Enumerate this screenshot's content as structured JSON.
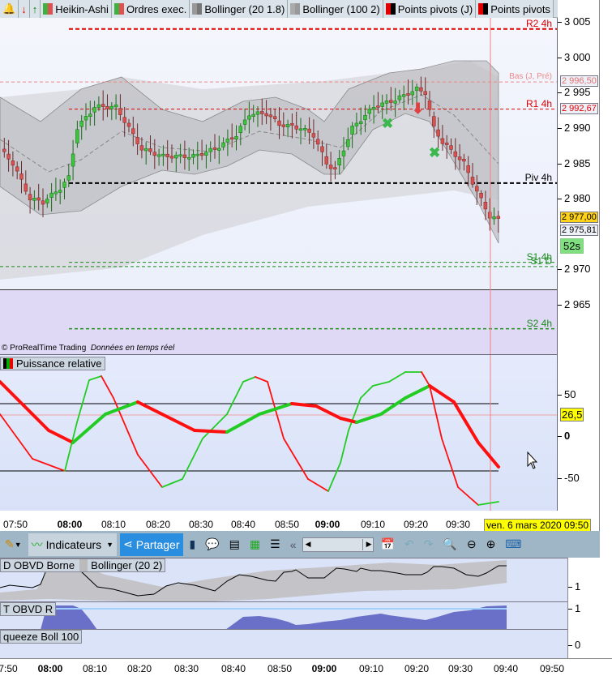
{
  "toolbar_top": {
    "items": [
      {
        "label": "Heikin-Ashi",
        "color": "#e05050",
        "color2": "#40b040"
      },
      {
        "label": "Ordres exec.",
        "color": "#e05050",
        "color2": "#40b040"
      },
      {
        "label": "Bollinger (20 1.8)",
        "color": "#777777",
        "color2": "#999999"
      },
      {
        "label": "Bollinger (100 2)",
        "color": "#999999",
        "color2": "#aaaaaa"
      },
      {
        "label": "Points pivots (J)",
        "color": "#000000",
        "color2": "#e00000"
      },
      {
        "label": "Points pivots",
        "color": "#000000",
        "color2": "#e00000"
      }
    ]
  },
  "price_axis": {
    "ticks": [
      "3 005",
      "3 000",
      "2 995",
      "2 990",
      "2 985",
      "2 980",
      "2 970",
      "2 965"
    ],
    "values": [
      3005,
      3000,
      2995,
      2990,
      2985,
      2980,
      2970,
      2965
    ],
    "tags": {
      "bas": "2 996,50",
      "r1": "2 992,67",
      "last": "2 977,00",
      "current": "2 975,81",
      "countdown": "52s"
    }
  },
  "levels": {
    "r2": "R2 4h",
    "bas": "Bas (J, Pré)",
    "r1": "R1 4h",
    "piv": "Piv 4h",
    "s1": "S1 4h",
    "s1d": "S1 D",
    "s2": "S2 4h"
  },
  "level_values": {
    "r2": 3004,
    "bas": 2996.5,
    "r1": 2992.67,
    "piv": 2982.2,
    "s1": 2971,
    "s1d": 2970.4,
    "s2": 2961.6
  },
  "copyright": "© ProRealTime Trading",
  "realtime": "Données en temps réel",
  "price_path": [
    [
      0,
      2987
    ],
    [
      3,
      2985
    ],
    [
      7,
      2980
    ],
    [
      10,
      2979.5
    ],
    [
      14,
      2981.5
    ],
    [
      16,
      2983
    ],
    [
      18,
      2990
    ],
    [
      22,
      2993
    ],
    [
      27,
      2993
    ],
    [
      30,
      2990
    ],
    [
      33,
      2987
    ],
    [
      38,
      2986
    ],
    [
      45,
      2986
    ],
    [
      50,
      2987
    ],
    [
      55,
      2989
    ],
    [
      58,
      2992
    ],
    [
      62,
      2992
    ],
    [
      65,
      2990.5
    ],
    [
      70,
      2990
    ],
    [
      73,
      2989
    ],
    [
      76,
      2985
    ],
    [
      78,
      2984
    ],
    [
      82,
      2990
    ],
    [
      87,
      2993
    ],
    [
      92,
      2994
    ],
    [
      97,
      2995.5
    ],
    [
      99,
      2995
    ],
    [
      101,
      2990
    ],
    [
      103,
      2988
    ],
    [
      108,
      2985
    ],
    [
      111,
      2981
    ],
    [
      114,
      2977.5
    ],
    [
      116,
      2977
    ]
  ],
  "oscillator": {
    "title": "Puissance relative",
    "ticks": [
      "50",
      "0",
      "-50"
    ],
    "tick_values": [
      50,
      0,
      -50
    ],
    "crosshair_value": "26,5"
  },
  "time_axis": {
    "labels": [
      "07:50",
      "08:00",
      "08:10",
      "08:20",
      "08:30",
      "08:40",
      "08:50",
      "09:00",
      "09:10",
      "09:20",
      "09:30"
    ],
    "bold": [
      "08:00",
      "09:00"
    ],
    "date_tooltip": "ven. 6 mars 2020 09:50"
  },
  "toolbar": {
    "indicators": "Indicateurs",
    "share": "Partager"
  },
  "panels": [
    {
      "labels": [
        "D OBVD Borne",
        "Bollinger (20 2)"
      ],
      "tick": "1"
    },
    {
      "labels": [
        "T OBVD R"
      ],
      "tick": "1"
    },
    {
      "labels": [
        "queeze Boll 100"
      ],
      "tick": "0"
    }
  ],
  "bottom_axis": {
    "labels": [
      "7:50",
      "08:00",
      "08:10",
      "08:20",
      "08:30",
      "08:40",
      "08:50",
      "09:00",
      "09:10",
      "09:20",
      "09:30",
      "09:40",
      "09:50"
    ]
  }
}
